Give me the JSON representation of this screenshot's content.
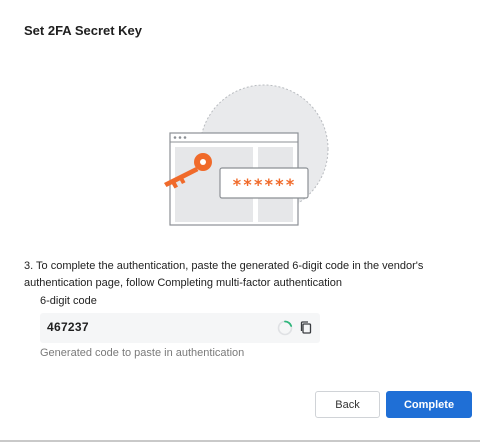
{
  "dialog": {
    "title": "Set 2FA Secret Key"
  },
  "illustration": {
    "password_mask": "******",
    "key_color": "#f06a2a",
    "icon": "browser-key-illustration"
  },
  "step": {
    "text": "3. To complete the authentication, paste the generated 6-digit code in the vendor's authentication page, follow Completing multi-factor authentication"
  },
  "code_field": {
    "label": "6-digit code",
    "value": "467237",
    "helper": "Generated code to paste in authentication",
    "spinner_color": "#2fb67c"
  },
  "buttons": {
    "back_label": "Back",
    "complete_label": "Complete",
    "primary_color": "#1f6fd6"
  }
}
